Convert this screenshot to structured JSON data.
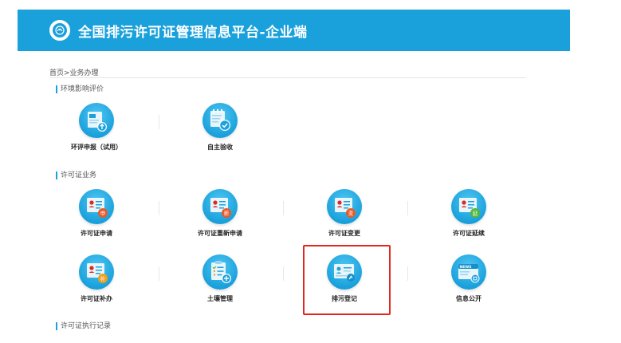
{
  "header": {
    "title": "全国排污许可证管理信息平台-企业端",
    "logo_icon": "environment-seal-icon",
    "bg_color": "#1aa1dc"
  },
  "breadcrumb": "首页>业务办理",
  "sections": {
    "eia": {
      "title": "环境影响评价",
      "items": [
        {
          "label": "环评申报（试用）",
          "icon": "document-upload-icon"
        },
        {
          "label": "自主验收",
          "icon": "checklist-approve-icon"
        }
      ]
    },
    "permit": {
      "title": "许可证业务",
      "items": [
        {
          "label": "许可证申请",
          "icon": "permit-apply-icon",
          "badge": "申",
          "badge_color": "#e85a2a"
        },
        {
          "label": "许可证重新申请",
          "icon": "permit-reapply-icon",
          "badge": "新",
          "badge_color": "#e85a2a"
        },
        {
          "label": "许可证变更",
          "icon": "permit-change-icon",
          "badge": "变",
          "badge_color": "#e85a2a"
        },
        {
          "label": "许可证延续",
          "icon": "permit-extend-icon",
          "badge": "延",
          "badge_color": "#55b63c"
        },
        {
          "label": "许可证补办",
          "icon": "permit-reissue-icon",
          "badge": "补",
          "badge_color": "#f0a020"
        },
        {
          "label": "土壤管理",
          "icon": "soil-management-icon"
        },
        {
          "label": "排污登记",
          "icon": "pollution-registration-icon"
        },
        {
          "label": "信息公开",
          "icon": "news-disclosure-icon",
          "news_text": "NEWS"
        }
      ]
    },
    "records": {
      "title": "许可证执行记录"
    }
  },
  "highlight_color": "#e0281f"
}
